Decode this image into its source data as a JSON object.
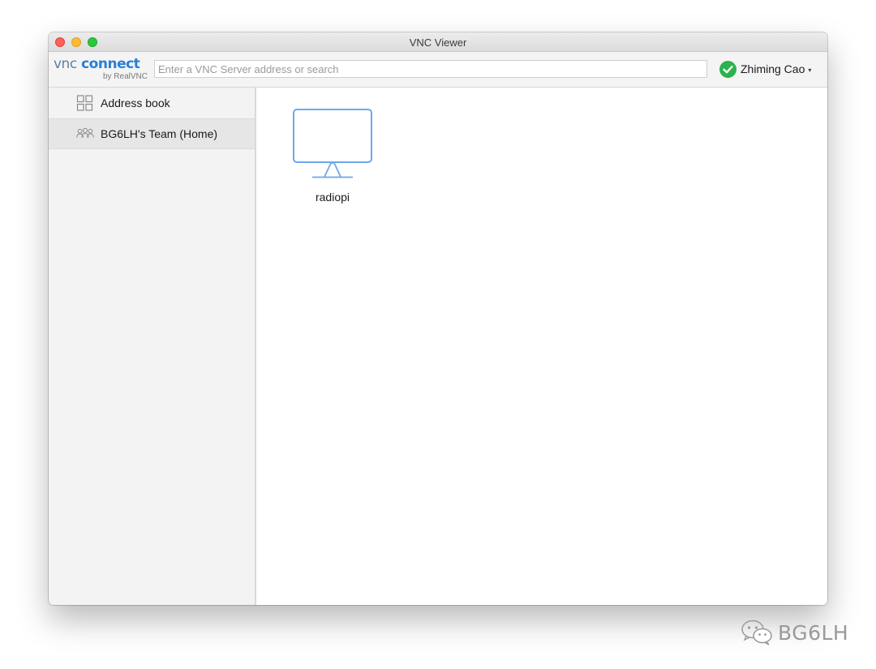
{
  "window": {
    "title": "VNC Viewer",
    "traffic_lights": {
      "close": "#fe5f57",
      "minimize": "#febc2e",
      "maximize": "#28c840"
    }
  },
  "toolbar": {
    "logo": {
      "vnc": "vnc",
      "connect": "connect",
      "by": "by RealVNC"
    },
    "search": {
      "placeholder": "Enter a VNC Server address or search",
      "value": ""
    },
    "user": {
      "name": "Zhiming Cao",
      "status_icon": "check-circle-icon",
      "status_color": "#2bb24c",
      "caret": "▾"
    }
  },
  "sidebar": {
    "items": [
      {
        "label": "Address book",
        "icon": "grid-icon",
        "selected": false
      },
      {
        "label": "BG6LH's Team (Home)",
        "icon": "team-icon",
        "selected": true
      }
    ]
  },
  "main": {
    "computers": [
      {
        "name": "radiopi",
        "icon": "monitor-icon"
      }
    ]
  },
  "watermark": {
    "text": "BG6LH",
    "icon": "wechat-icon"
  },
  "colors": {
    "accent": "#2a7fd4",
    "monitor_stroke": "#6aa9ee",
    "sidebar_bg": "#f3f3f3",
    "sidebar_selected": "#e6e6e6"
  }
}
